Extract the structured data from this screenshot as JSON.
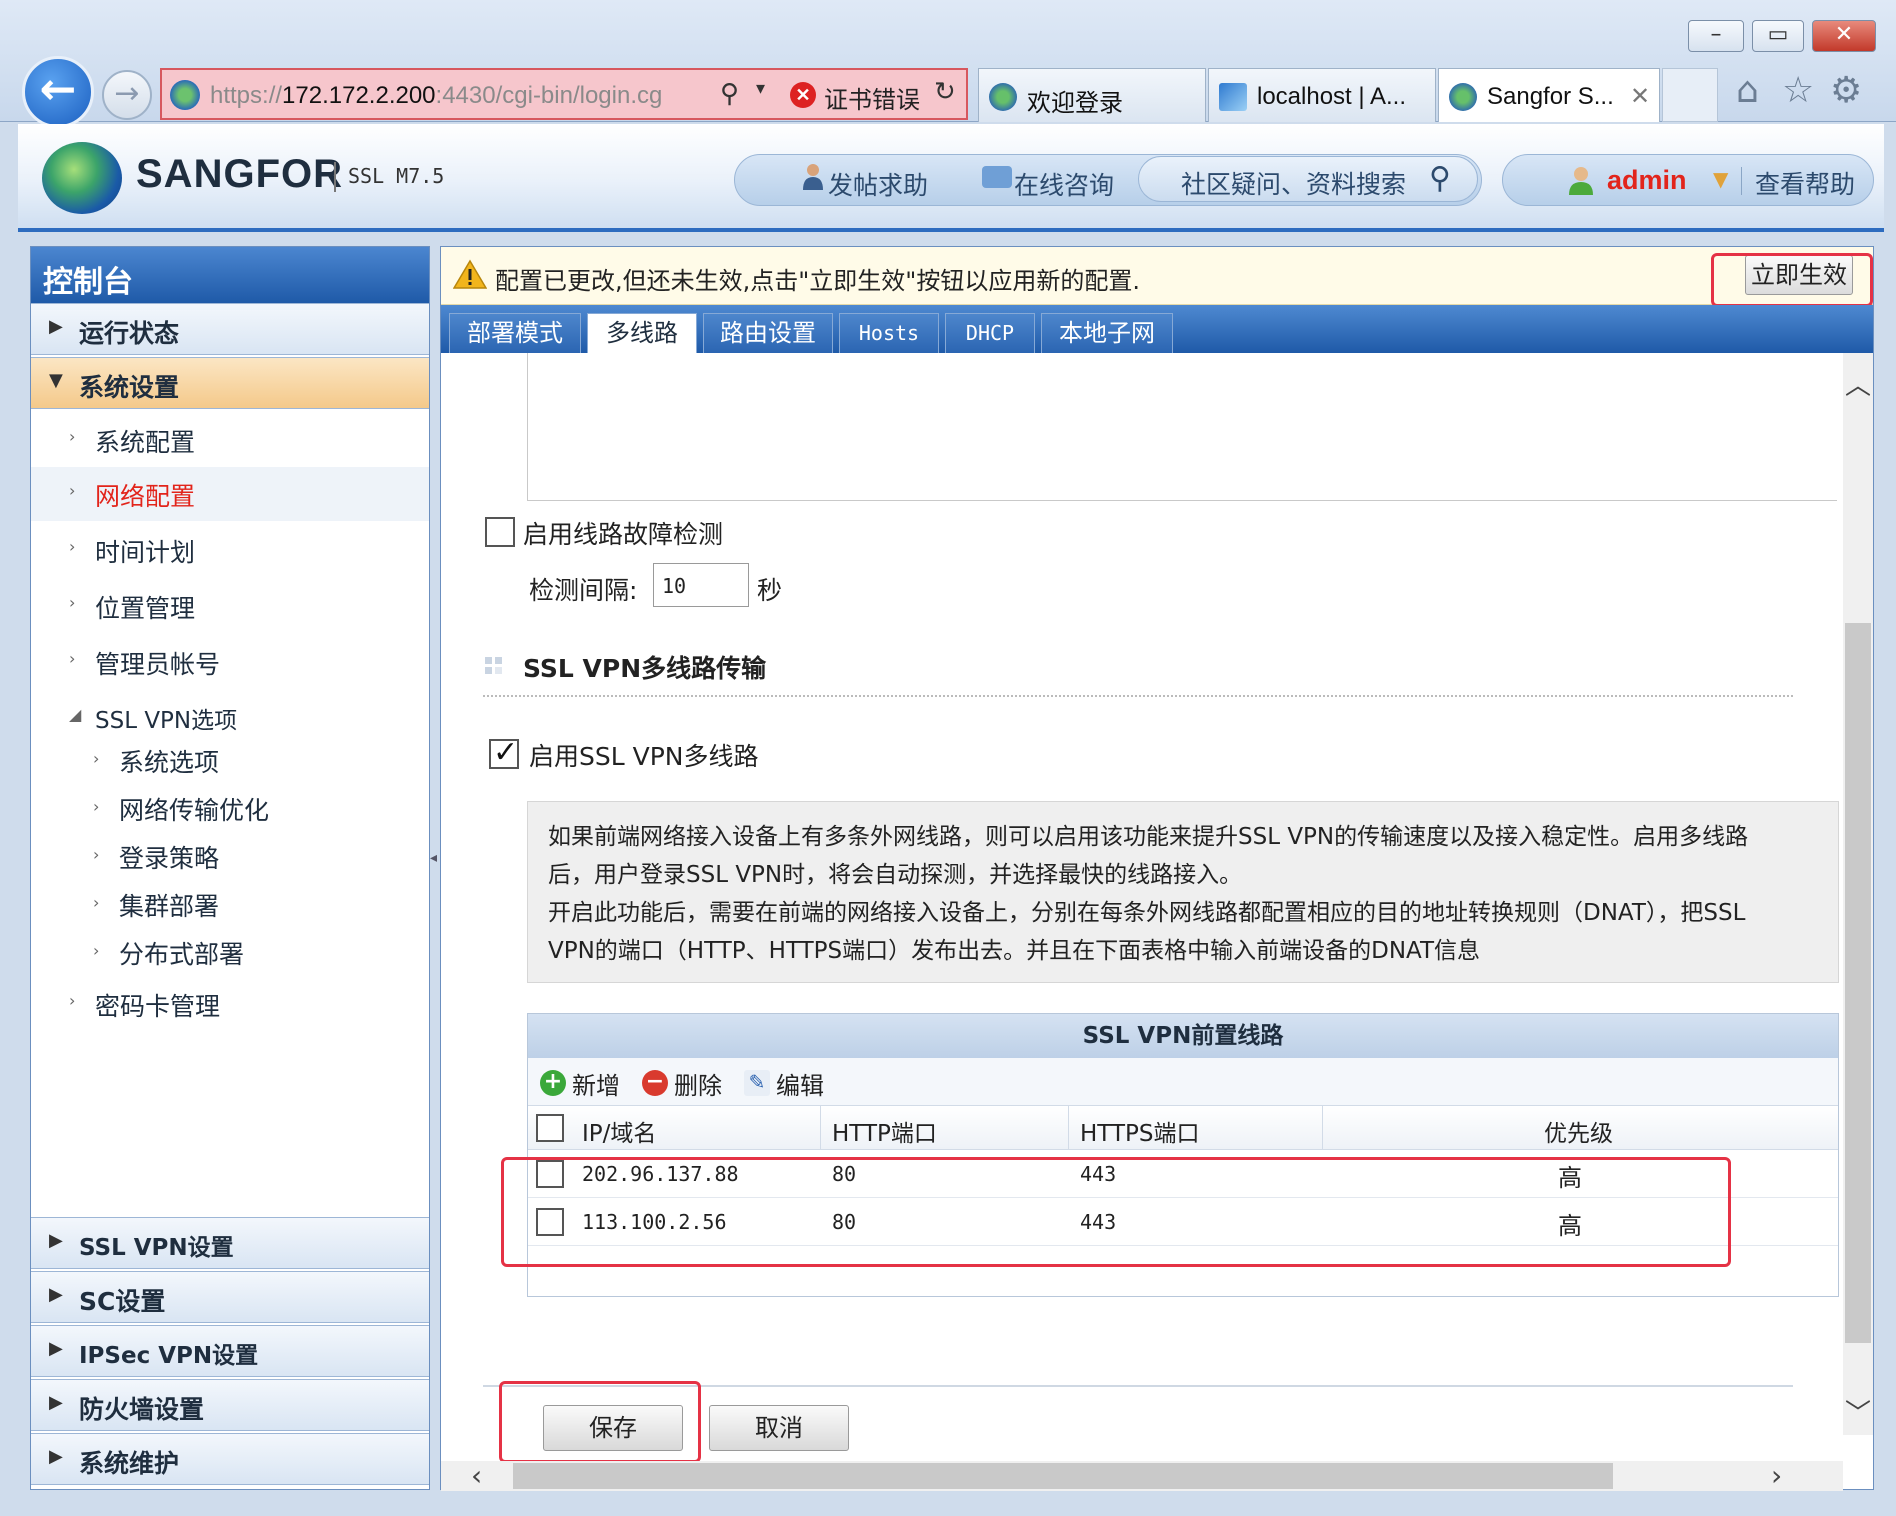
{
  "browser": {
    "address": {
      "url_scheme": "https://",
      "url_host": "172.172.2.200",
      "url_rest": ":4430/cgi-bin/login.cg",
      "cert_error": "证书错误"
    },
    "tabs": [
      {
        "label": "欢迎登录"
      },
      {
        "label": "localhost | A..."
      },
      {
        "label": "Sangfor S..."
      }
    ]
  },
  "header": {
    "brand": "SANGFOR",
    "product": "SSL M7.5",
    "nav": {
      "help_post": "发帖求助",
      "online_consult": "在线咨询",
      "community_search": "社区疑问、资料搜索"
    },
    "user": "admin",
    "view_help": "查看帮助"
  },
  "sidebar": {
    "title": "控制台",
    "sections": {
      "run_status": "运行状态",
      "system_settings": "系统设置",
      "ssl_vpn_settings": "SSL VPN设置",
      "sc_settings": "SC设置",
      "ipsec_settings": "IPSec VPN设置",
      "firewall_settings": "防火墙设置",
      "system_maintenance": "系统维护"
    },
    "items": [
      {
        "label": "系统配置"
      },
      {
        "label": "网络配置"
      },
      {
        "label": "时间计划"
      },
      {
        "label": "位置管理"
      },
      {
        "label": "管理员帐号"
      },
      {
        "label": "SSL VPN选项"
      },
      {
        "label": "密码卡管理"
      }
    ],
    "sub_items": [
      {
        "label": "系统选项"
      },
      {
        "label": "网络传输优化"
      },
      {
        "label": "登录策略"
      },
      {
        "label": "集群部署"
      },
      {
        "label": "分布式部署"
      }
    ]
  },
  "notice": {
    "text": "配置已更改,但还未生效,点击\"立即生效\"按钮以应用新的配置.",
    "apply_button": "立即生效"
  },
  "content_tabs": [
    {
      "label": "部署模式"
    },
    {
      "label": "多线路"
    },
    {
      "label": "路由设置"
    },
    {
      "label": "Hosts"
    },
    {
      "label": "DHCP"
    },
    {
      "label": "本地子网"
    }
  ],
  "form": {
    "fault_detection_label": "启用线路故障检测",
    "interval_label": "检测间隔:",
    "interval_value": "10",
    "interval_unit": "秒",
    "section_title": "SSL VPN多线路传输",
    "enable_multiline_label": "启用SSL VPN多线路",
    "enable_multiline_checked": true,
    "description_lines": [
      "如果前端网络接入设备上有多条外网线路，则可以启用该功能来提升SSL VPN的传输速度以及接入稳定性。启用多线路",
      "后，用户登录SSL VPN时，将会自动探测，并选择最快的线路接入。",
      "开启此功能后，需要在前端的网络接入设备上，分别在每条外网线路都配置相应的目的地址转换规则（DNAT），把SSL",
      "VPN的端口（HTTP、HTTPS端口）发布出去。并且在下面表格中输入前端设备的DNAT信息"
    ]
  },
  "table": {
    "title": "SSL VPN前置线路",
    "toolbar": {
      "add": "新增",
      "delete": "删除",
      "edit": "编辑"
    },
    "columns": [
      "IP/域名",
      "HTTP端口",
      "HTTPS端口",
      "优先级"
    ],
    "rows": [
      {
        "ip": "202.96.137.88",
        "http": "80",
        "https": "443",
        "priority": "高"
      },
      {
        "ip": "113.100.2.56",
        "http": "80",
        "https": "443",
        "priority": "高"
      }
    ]
  },
  "buttons": {
    "save": "保存",
    "cancel": "取消"
  },
  "colors": {
    "accent_blue": "#1f5aa8",
    "highlight_red": "#e53245",
    "active_orange": "#f4c98a"
  }
}
